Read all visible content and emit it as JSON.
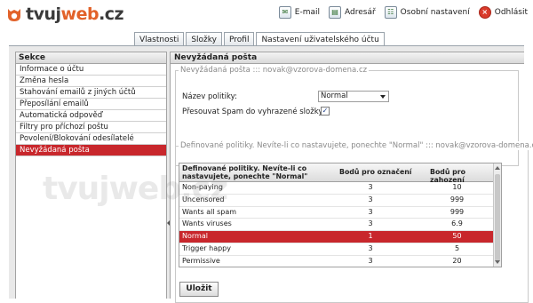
{
  "brand": {
    "name_prefix": "tvuj",
    "name_accent": "web",
    "name_suffix": ".cz",
    "accent_color": "#e2622a"
  },
  "header": {
    "links": [
      {
        "label": "E-mail",
        "icon": "email-icon"
      },
      {
        "label": "Adresář",
        "icon": "address-book-icon"
      },
      {
        "label": "Osobní nastavení",
        "icon": "personal-settings-icon"
      },
      {
        "label": "Odhlásit",
        "icon": "logout-icon"
      }
    ]
  },
  "tabs": [
    "Vlastnosti",
    "Složky",
    "Profil",
    "Nastavení uživatelského účtu"
  ],
  "sidebar": {
    "title": "Sekce",
    "items": [
      "Informace o účtu",
      "Změna hesla",
      "Stahování emailů z jiných účtů",
      "Přeposílání emailů",
      "Automatická odpověď",
      "Filtry pro příchozí poštu",
      "Povolení/Blokování odesílatelé",
      "Nevyžádaná pošta"
    ],
    "active_index": 7
  },
  "content": {
    "title": "Nevyžádaná pošta",
    "fieldset1_legend": "Nevyžádaná pošta ::: novak@vzorova-domena.cz",
    "policy_label": "Název politiky:",
    "policy_value": "Normal",
    "move_spam_label": "Přesouvat Spam do vyhrazené složky:",
    "move_spam_checked": "✓",
    "fieldset2_legend": "Definované politiky. Nevíte-li co nastavujete, ponechte \"Normal\" ::: novak@vzorova-domena.cz",
    "table": {
      "headers": [
        "Definované politiky. Nevíte-li co nastavujete, ponechte \"Normal\"",
        "Bodů pro označení",
        "Bodů pro zahození"
      ],
      "rows": [
        [
          "Non-paying",
          "3",
          "10"
        ],
        [
          "Uncensored",
          "3",
          "999"
        ],
        [
          "Wants all spam",
          "3",
          "999"
        ],
        [
          "Wants viruses",
          "3",
          "6.9"
        ],
        [
          "Normal",
          "1",
          "50"
        ],
        [
          "Trigger happy",
          "3",
          "5"
        ],
        [
          "Permissive",
          "3",
          "20"
        ]
      ],
      "selected_index": 4
    },
    "save_label": "Uložit"
  },
  "watermark": "tvujweb.cz",
  "colors": {
    "selection": "#c8272c",
    "panel_bg": "#e9e9e9"
  }
}
